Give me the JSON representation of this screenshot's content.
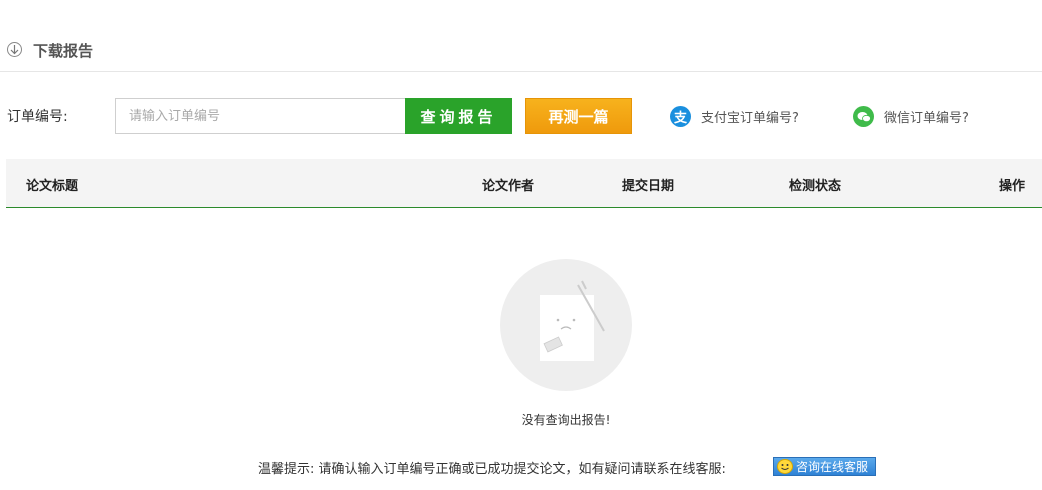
{
  "header": {
    "title": "下载报告",
    "icon": "download-icon"
  },
  "form": {
    "label": "订单编号:",
    "input_placeholder": "请输入订单编号",
    "input_value": "",
    "query_button": "查询报告",
    "retest_button": "再测一篇"
  },
  "help_links": {
    "alipay": {
      "label": "支付宝订单编号?",
      "icon": "alipay-icon",
      "color": "#1a8fde"
    },
    "wechat": {
      "label": "微信订单编号?",
      "icon": "wechat-icon",
      "color": "#3fbb4a"
    }
  },
  "table": {
    "columns": [
      "论文标题",
      "论文作者",
      "提交日期",
      "检测状态",
      "操作"
    ],
    "rows": []
  },
  "empty_state": {
    "message": "没有查询出报告!",
    "icon": "empty-document-icon"
  },
  "footer": {
    "tip": "温馨提示: 请确认输入订单编号正确或已成功提交论文，如有疑问请联系在线客服:",
    "service_button": "咨询在线客服"
  },
  "colors": {
    "primary_green": "#2aa32a",
    "orange": "#f7a716",
    "blue": "#2f82d5"
  }
}
